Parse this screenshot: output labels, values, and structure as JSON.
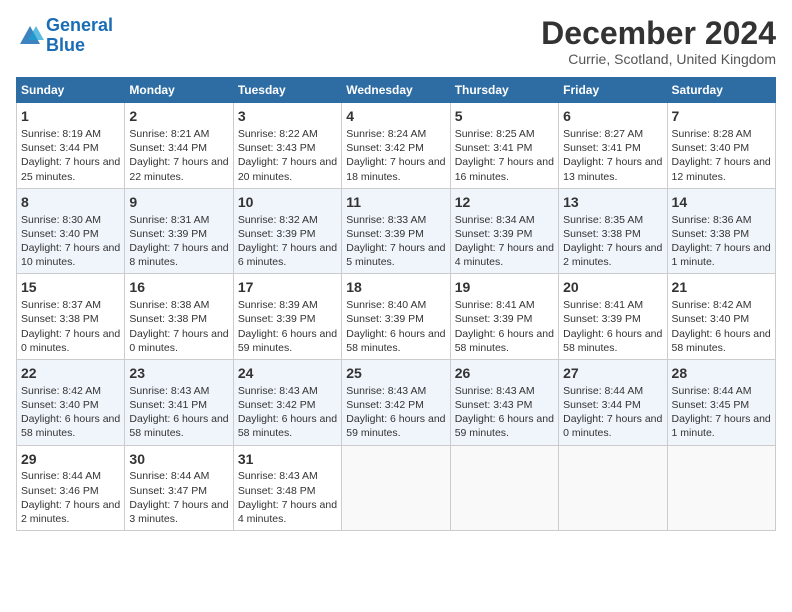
{
  "logo": {
    "line1": "General",
    "line2": "Blue"
  },
  "title": "December 2024",
  "subtitle": "Currie, Scotland, United Kingdom",
  "days": [
    "Sunday",
    "Monday",
    "Tuesday",
    "Wednesday",
    "Thursday",
    "Friday",
    "Saturday"
  ],
  "weeks": [
    [
      {
        "num": "1",
        "sunrise": "8:19 AM",
        "sunset": "3:44 PM",
        "daylight": "7 hours and 25 minutes."
      },
      {
        "num": "2",
        "sunrise": "8:21 AM",
        "sunset": "3:44 PM",
        "daylight": "7 hours and 22 minutes."
      },
      {
        "num": "3",
        "sunrise": "8:22 AM",
        "sunset": "3:43 PM",
        "daylight": "7 hours and 20 minutes."
      },
      {
        "num": "4",
        "sunrise": "8:24 AM",
        "sunset": "3:42 PM",
        "daylight": "7 hours and 18 minutes."
      },
      {
        "num": "5",
        "sunrise": "8:25 AM",
        "sunset": "3:41 PM",
        "daylight": "7 hours and 16 minutes."
      },
      {
        "num": "6",
        "sunrise": "8:27 AM",
        "sunset": "3:41 PM",
        "daylight": "7 hours and 13 minutes."
      },
      {
        "num": "7",
        "sunrise": "8:28 AM",
        "sunset": "3:40 PM",
        "daylight": "7 hours and 12 minutes."
      }
    ],
    [
      {
        "num": "8",
        "sunrise": "8:30 AM",
        "sunset": "3:40 PM",
        "daylight": "7 hours and 10 minutes."
      },
      {
        "num": "9",
        "sunrise": "8:31 AM",
        "sunset": "3:39 PM",
        "daylight": "7 hours and 8 minutes."
      },
      {
        "num": "10",
        "sunrise": "8:32 AM",
        "sunset": "3:39 PM",
        "daylight": "7 hours and 6 minutes."
      },
      {
        "num": "11",
        "sunrise": "8:33 AM",
        "sunset": "3:39 PM",
        "daylight": "7 hours and 5 minutes."
      },
      {
        "num": "12",
        "sunrise": "8:34 AM",
        "sunset": "3:39 PM",
        "daylight": "7 hours and 4 minutes."
      },
      {
        "num": "13",
        "sunrise": "8:35 AM",
        "sunset": "3:38 PM",
        "daylight": "7 hours and 2 minutes."
      },
      {
        "num": "14",
        "sunrise": "8:36 AM",
        "sunset": "3:38 PM",
        "daylight": "7 hours and 1 minute."
      }
    ],
    [
      {
        "num": "15",
        "sunrise": "8:37 AM",
        "sunset": "3:38 PM",
        "daylight": "7 hours and 0 minutes."
      },
      {
        "num": "16",
        "sunrise": "8:38 AM",
        "sunset": "3:38 PM",
        "daylight": "7 hours and 0 minutes."
      },
      {
        "num": "17",
        "sunrise": "8:39 AM",
        "sunset": "3:39 PM",
        "daylight": "6 hours and 59 minutes."
      },
      {
        "num": "18",
        "sunrise": "8:40 AM",
        "sunset": "3:39 PM",
        "daylight": "6 hours and 58 minutes."
      },
      {
        "num": "19",
        "sunrise": "8:41 AM",
        "sunset": "3:39 PM",
        "daylight": "6 hours and 58 minutes."
      },
      {
        "num": "20",
        "sunrise": "8:41 AM",
        "sunset": "3:39 PM",
        "daylight": "6 hours and 58 minutes."
      },
      {
        "num": "21",
        "sunrise": "8:42 AM",
        "sunset": "3:40 PM",
        "daylight": "6 hours and 58 minutes."
      }
    ],
    [
      {
        "num": "22",
        "sunrise": "8:42 AM",
        "sunset": "3:40 PM",
        "daylight": "6 hours and 58 minutes."
      },
      {
        "num": "23",
        "sunrise": "8:43 AM",
        "sunset": "3:41 PM",
        "daylight": "6 hours and 58 minutes."
      },
      {
        "num": "24",
        "sunrise": "8:43 AM",
        "sunset": "3:42 PM",
        "daylight": "6 hours and 58 minutes."
      },
      {
        "num": "25",
        "sunrise": "8:43 AM",
        "sunset": "3:42 PM",
        "daylight": "6 hours and 59 minutes."
      },
      {
        "num": "26",
        "sunrise": "8:43 AM",
        "sunset": "3:43 PM",
        "daylight": "6 hours and 59 minutes."
      },
      {
        "num": "27",
        "sunrise": "8:44 AM",
        "sunset": "3:44 PM",
        "daylight": "7 hours and 0 minutes."
      },
      {
        "num": "28",
        "sunrise": "8:44 AM",
        "sunset": "3:45 PM",
        "daylight": "7 hours and 1 minute."
      }
    ],
    [
      {
        "num": "29",
        "sunrise": "8:44 AM",
        "sunset": "3:46 PM",
        "daylight": "7 hours and 2 minutes."
      },
      {
        "num": "30",
        "sunrise": "8:44 AM",
        "sunset": "3:47 PM",
        "daylight": "7 hours and 3 minutes."
      },
      {
        "num": "31",
        "sunrise": "8:43 AM",
        "sunset": "3:48 PM",
        "daylight": "7 hours and 4 minutes."
      },
      null,
      null,
      null,
      null
    ]
  ]
}
